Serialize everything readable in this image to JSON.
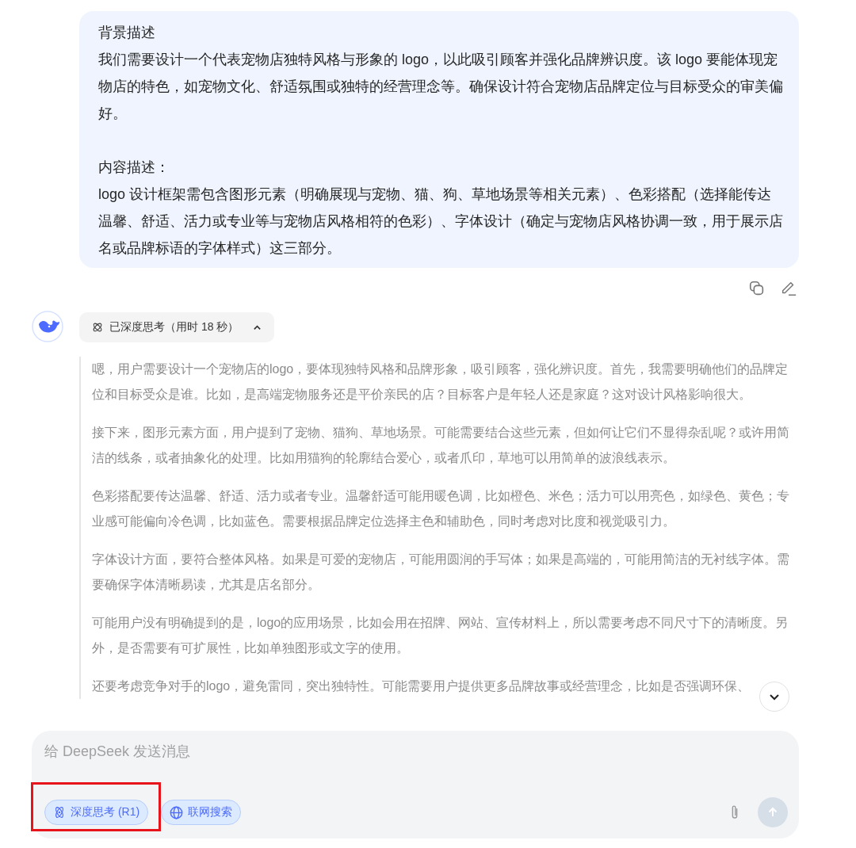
{
  "user_message": {
    "paragraphs": [
      {
        "heading": "背景描述",
        "body": "我们需要设计一个代表宠物店独特风格与形象的 logo，以此吸引顾客并强化品牌辨识度。该 logo 要能体现宠物店的特色，如宠物文化、舒适氛围或独特的经营理念等。确保设计符合宠物店品牌定位与目标受众的审美偏好。"
      },
      {
        "heading": "内容描述：",
        "body": "logo 设计框架需包含图形元素（明确展现与宠物、猫、狗、草地场景等相关元素）、色彩搭配（选择能传达温馨、舒适、活力或专业等与宠物店风格相符的色彩）、字体设计（确定与宠物店风格协调一致，用于展示店名或品牌标语的字体样式）这三部分。"
      }
    ]
  },
  "thinking": {
    "label": "已深度思考（用时 18 秒）",
    "expanded": true,
    "paragraphs": [
      "嗯，用户需要设计一个宠物店的logo，要体现独特风格和品牌形象，吸引顾客，强化辨识度。首先，我需要明确他们的品牌定位和目标受众是谁。比如，是高端宠物服务还是平价亲民的店？目标客户是年轻人还是家庭？这对设计风格影响很大。",
      "接下来，图形元素方面，用户提到了宠物、猫狗、草地场景。可能需要结合这些元素，但如何让它们不显得杂乱呢？或许用简洁的线条，或者抽象化的处理。比如用猫狗的轮廓结合爱心，或者爪印，草地可以用简单的波浪线表示。",
      "色彩搭配要传达温馨、舒适、活力或者专业。温馨舒适可能用暖色调，比如橙色、米色；活力可以用亮色，如绿色、黄色；专业感可能偏向冷色调，比如蓝色。需要根据品牌定位选择主色和辅助色，同时考虑对比度和视觉吸引力。",
      "字体设计方面，要符合整体风格。如果是可爱的宠物店，可能用圆润的手写体；如果是高端的，可能用简洁的无衬线字体。需要确保字体清晰易读，尤其是店名部分。",
      "可能用户没有明确提到的是，logo的应用场景，比如会用在招牌、网站、宣传材料上，所以需要考虑不同尺寸下的清晰度。另外，是否需要有可扩展性，比如单独图形或文字的使用。",
      "还要考虑竞争对手的logo，避免雷同，突出独特性。可能需要用户提供更多品牌故事或经营理念，比如是否强调环保、"
    ]
  },
  "composer": {
    "placeholder": "给 DeepSeek 发送消息",
    "chips": [
      {
        "kind": "think",
        "label": "深度思考 (R1)",
        "selected": true,
        "annotated": true
      },
      {
        "kind": "search",
        "label": "联网搜索",
        "selected": true,
        "annotated": false
      }
    ],
    "send_disabled": true
  }
}
